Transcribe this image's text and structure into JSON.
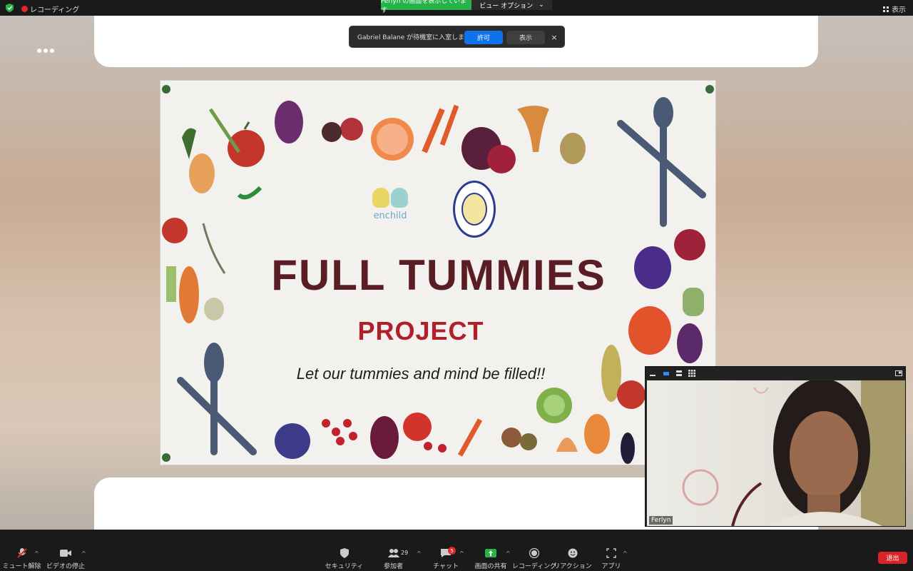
{
  "topbar": {
    "recording_label": "レコーディング",
    "share_banner": "Ferlyn の画面を表示しています",
    "view_options": "ビュー オプション",
    "view_options_caret": "⌄",
    "view_label": "表示"
  },
  "notification": {
    "message": "Gabriel Balane が待機室に入室しました",
    "allow_label": "許可",
    "show_label": "表示",
    "close_glyph": "×"
  },
  "shared_content": {
    "logo_text": "enchild",
    "title": "FULL TUMMIES",
    "subtitle": "PROJECT",
    "tagline": "Let our tummies and mind be filled!!"
  },
  "video": {
    "participant_name": "Ferlyn"
  },
  "toolbar": {
    "mute_label": "ミュート解除",
    "video_label": "ビデオの停止",
    "security_label": "セキュリティ",
    "participants_label": "参加者",
    "participants_count": "29",
    "chat_label": "チャット",
    "chat_badge": "5",
    "share_label": "画面の共有",
    "record_label": "レコーディング",
    "reaction_label": "リアクション",
    "apps_label": "アプリ",
    "leave_label": "退出",
    "caret": "^"
  },
  "colors": {
    "share_green": "#26b34a",
    "allow_blue": "#0e72ed",
    "leave_red": "#d8232a",
    "title_maroon": "#5a1d24",
    "subtitle_red": "#b0202b"
  }
}
